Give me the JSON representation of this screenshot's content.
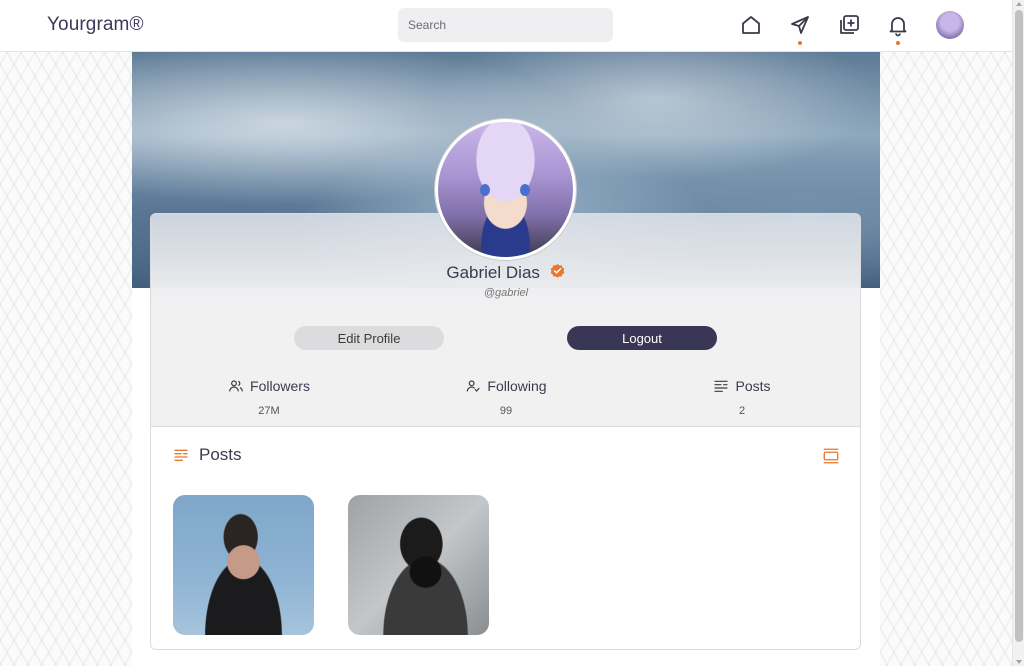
{
  "header": {
    "logo": "Yourgram®",
    "search_placeholder": "Search",
    "icons": [
      "home-icon",
      "send-icon",
      "add-post-icon",
      "bell-icon",
      "avatar"
    ]
  },
  "profile": {
    "name": "Gabriel Dias",
    "handle": "@gabriel",
    "verified": true,
    "edit_label": "Edit Profile",
    "logout_label": "Logout",
    "stats": [
      {
        "label": "Followers",
        "value": "27M",
        "icon": "followers-icon"
      },
      {
        "label": "Following",
        "value": "99",
        "icon": "following-icon"
      },
      {
        "label": "Posts",
        "value": "2",
        "icon": "posts-icon"
      }
    ]
  },
  "posts": {
    "title": "Posts",
    "items": [
      {
        "alt": "portrait-blue-sky"
      },
      {
        "alt": "portrait-black-mask"
      }
    ]
  },
  "colors": {
    "accent": "#e8772e",
    "primary_dark": "#3a3655",
    "verified": "#e8772e"
  }
}
